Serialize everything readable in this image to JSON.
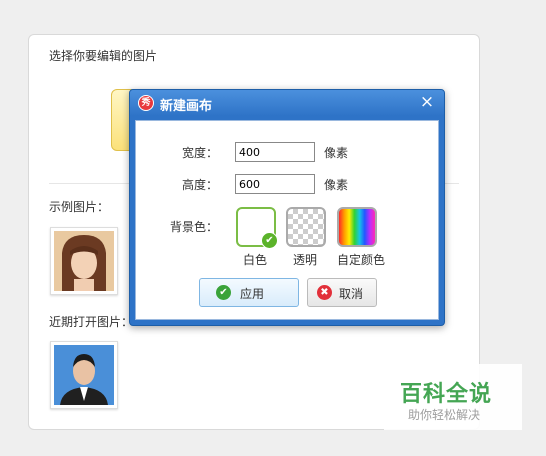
{
  "panel": {
    "title": "选择你要编辑的图片",
    "example_label": "示例图片：",
    "recent_label": "近期打开图片："
  },
  "dialog": {
    "title": "新建画布",
    "logo_text": "秀",
    "close_icon": "×",
    "width_label": "宽度：",
    "width_value": "400",
    "height_label": "高度：",
    "height_value": "600",
    "unit": "像素",
    "bg_label": "背景色：",
    "swatches": [
      "白色",
      "透明",
      "自定颜色"
    ],
    "ok_label": "应用",
    "cancel_label": "取消",
    "ok_icon": "✔",
    "cancel_icon": "✖",
    "check_icon": "✔"
  },
  "watermark": {
    "main": "百科全说",
    "sub": "助你轻松解决"
  },
  "colors": {
    "dialog_blue": "#2e73c7",
    "selected_green": "#7bbd45",
    "watermark_green": "#3aa14a"
  }
}
